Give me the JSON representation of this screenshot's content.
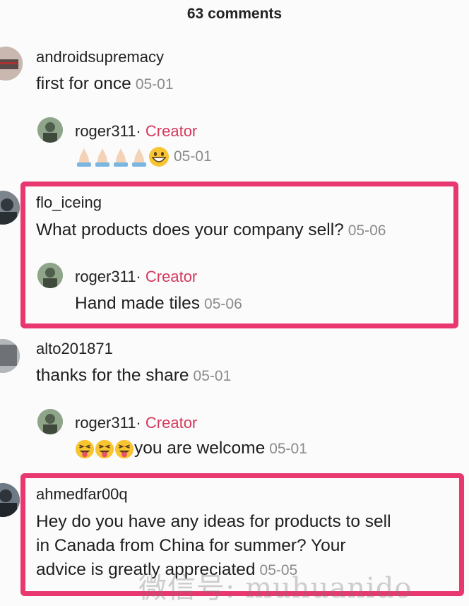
{
  "header": {
    "title": "63 comments"
  },
  "comments": [
    {
      "username": "androidsupremacy",
      "text": "first for once",
      "date": "05-01",
      "reply": {
        "username": "roger311·",
        "badge": "Creator",
        "text": "",
        "emojis": [
          "folded-hands-icon",
          "folded-hands-icon",
          "folded-hands-icon",
          "folded-hands-icon",
          "grinning-face-icon"
        ],
        "date": "05-01"
      }
    },
    {
      "username": "flo_iceing",
      "text": "What products does your company sell?",
      "date": "05-06",
      "reply": {
        "username": "roger311·",
        "badge": "Creator",
        "text": "Hand made tiles",
        "date": "05-06"
      }
    },
    {
      "username": "alto201871",
      "text": "thanks for the share",
      "date": "05-01",
      "reply": {
        "username": "roger311·",
        "badge": "Creator",
        "text": "you are welcome",
        "emojis": [
          "tongue-face-icon",
          "tongue-face-icon",
          "tongue-face-icon"
        ],
        "date": "05-01"
      }
    },
    {
      "username": "ahmedfar00q",
      "text_lines": [
        "Hey do you have any ideas for products to sell",
        "in Canada from China for summer? Your",
        "advice is greatly appreciated"
      ],
      "date": "05-05"
    }
  ],
  "watermark": "微信号: muhuanido",
  "colors": {
    "highlight": "#e8386f",
    "creator": "#d4395c",
    "date": "#8a8a8a"
  }
}
